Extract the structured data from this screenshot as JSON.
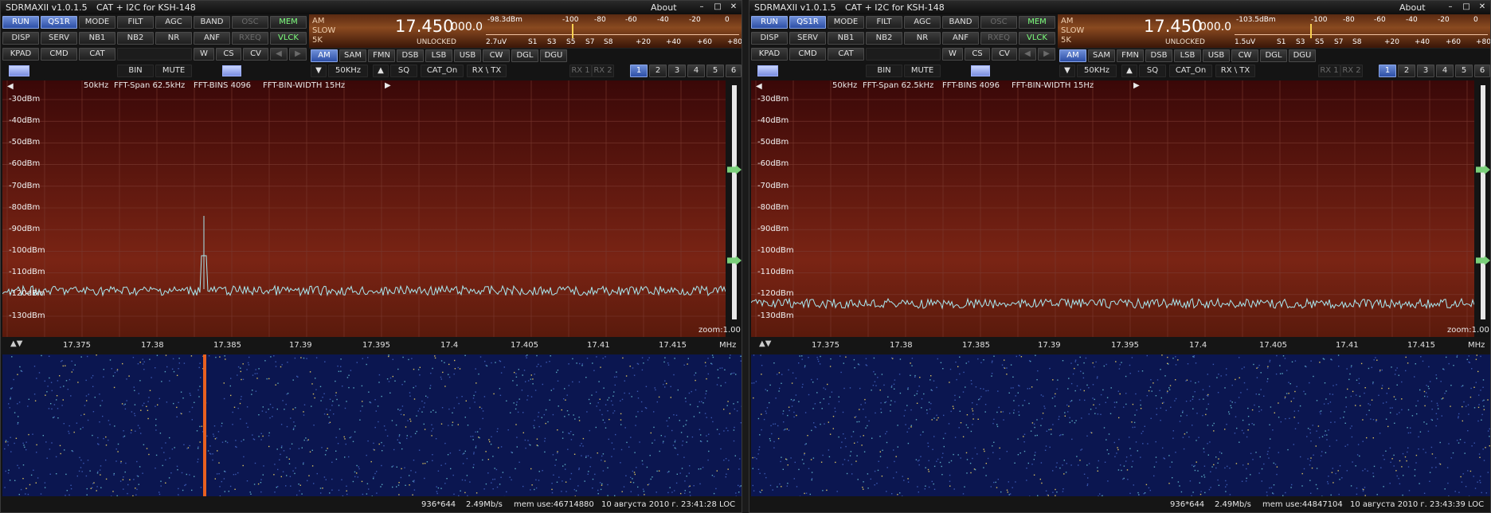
{
  "windows": [
    {
      "title": {
        "app": "SDRMAXII v1.0.1.5",
        "sub": "CAT + I2C for  KSH-148",
        "about": "About"
      },
      "row1": [
        "RUN",
        "QS1R",
        "MODE",
        "FILT",
        "AGC",
        "BAND",
        "OSC",
        "MEM"
      ],
      "row2": [
        "DISP",
        "SERV",
        "NB1",
        "NB2",
        "NR",
        "ANF",
        "RXEQ",
        "VLCK"
      ],
      "row3": [
        "KPAD",
        "CMD",
        "CAT",
        "W",
        "CS",
        "CV"
      ],
      "row4": [
        "BIN",
        "MUTE"
      ],
      "modes": [
        "AM",
        "SAM",
        "FMN",
        "DSB",
        "LSB",
        "USB",
        "CW",
        "DGL",
        "DGU"
      ],
      "bottom": {
        "span": "50KHz",
        "sq": "SQ",
        "cat": "CAT_On",
        "rxtx": "RX \\ TX",
        "rx1": "RX 1",
        "rx2": "RX 2",
        "nums": [
          "1",
          "2",
          "3",
          "4",
          "5",
          "6"
        ]
      },
      "panel": {
        "mode1": "AM",
        "mode2": "SLOW",
        "mode3": "5K",
        "freq": "17.450",
        "freq_sub": "000.0",
        "lock": "UNLOCKED",
        "dbm": "-98.3dBm",
        "uv": "2.7uV",
        "smeter_level": 0.34,
        "scale_top": [
          "-100",
          "-80",
          "-60",
          "-40",
          "-20",
          "0"
        ],
        "scale_bottom": [
          "S1",
          "S3",
          "S5",
          "S7",
          "S8",
          "+20",
          "+40",
          "+60",
          "+80"
        ]
      },
      "spectrum": {
        "info": [
          "50kHz",
          "FFT-Span 62.5kHz",
          "FFT-BINS 4096",
          "FFT-BIN-WIDTH 15Hz"
        ],
        "db_labels": [
          "-30dBm",
          "-40dBm",
          "-50dBm",
          "-60dBm",
          "-70dBm",
          "-80dBm",
          "-90dBm",
          "-100dBm",
          "-110dBm",
          "-120dBm",
          "-130dBm"
        ],
        "zoom": "zoom:1.00"
      },
      "freq_ticks": [
        "17.375",
        "17.38",
        "17.385",
        "17.39",
        "17.395",
        "17.4",
        "17.405",
        "17.41",
        "17.415"
      ],
      "freq_unit": "MHz",
      "status": {
        "res": "936*644",
        "rate": "2.49Mb/s",
        "mem": "mem use:46714880",
        "date": "10 августа 2010 г. 23:41:28 LOC"
      },
      "colors": {
        "trace": "#a8e8f0",
        "spectrum_top": "#3a0808",
        "waterfall": "#0b1650",
        "blue_btn": "#2d4fa6"
      }
    },
    {
      "title": {
        "app": "SDRMAXII v1.0.1.5",
        "sub": "CAT + I2C for  KSH-148",
        "about": "About"
      },
      "row1": [
        "RUN",
        "QS1R",
        "MODE",
        "FILT",
        "AGC",
        "BAND",
        "OSC",
        "MEM"
      ],
      "row2": [
        "DISP",
        "SERV",
        "NB1",
        "NB2",
        "NR",
        "ANF",
        "RXEQ",
        "VLCK"
      ],
      "row3": [
        "KPAD",
        "CMD",
        "CAT",
        "W",
        "CS",
        "CV"
      ],
      "row4": [
        "BIN",
        "MUTE"
      ],
      "modes": [
        "AM",
        "SAM",
        "FMN",
        "DSB",
        "LSB",
        "USB",
        "CW",
        "DGL",
        "DGU"
      ],
      "bottom": {
        "span": "50KHz",
        "sq": "SQ",
        "cat": "CAT_On",
        "rxtx": "RX \\ TX",
        "rx1": "RX 1",
        "rx2": "RX 2",
        "nums": [
          "1",
          "2",
          "3",
          "4",
          "5",
          "6"
        ]
      },
      "panel": {
        "mode1": "AM",
        "mode2": "SLOW",
        "mode3": "5K",
        "freq": "17.450",
        "freq_sub": "000.0",
        "lock": "UNLOCKED",
        "dbm": "-103.5dBm",
        "uv": "1.5uV",
        "smeter_level": 0.3,
        "scale_top": [
          "-100",
          "-80",
          "-60",
          "-40",
          "-20",
          "0"
        ],
        "scale_bottom": [
          "S1",
          "S3",
          "S5",
          "S7",
          "S8",
          "+20",
          "+40",
          "+60",
          "+80"
        ]
      },
      "spectrum": {
        "info": [
          "50kHz",
          "FFT-Span 62.5kHz",
          "FFT-BINS 4096",
          "FFT-BIN-WIDTH 15Hz"
        ],
        "db_labels": [
          "-30dBm",
          "-40dBm",
          "-50dBm",
          "-60dBm",
          "-70dBm",
          "-80dBm",
          "-90dBm",
          "-100dBm",
          "-110dBm",
          "-120dBm",
          "-130dBm"
        ],
        "zoom": "zoom:1.00"
      },
      "freq_ticks": [
        "17.375",
        "17.38",
        "17.385",
        "17.39",
        "17.395",
        "17.4",
        "17.405",
        "17.41",
        "17.415"
      ],
      "freq_unit": "MHz",
      "status": {
        "res": "936*644",
        "rate": "2.49Mb/s",
        "mem": "mem use:44847104",
        "date": "10 августа 2010 г. 23:43:39 LOC"
      },
      "colors": {
        "trace": "#a8e8f0",
        "spectrum_top": "#3a0808",
        "waterfall": "#0b1650",
        "blue_btn": "#2d4fa6"
      }
    }
  ]
}
